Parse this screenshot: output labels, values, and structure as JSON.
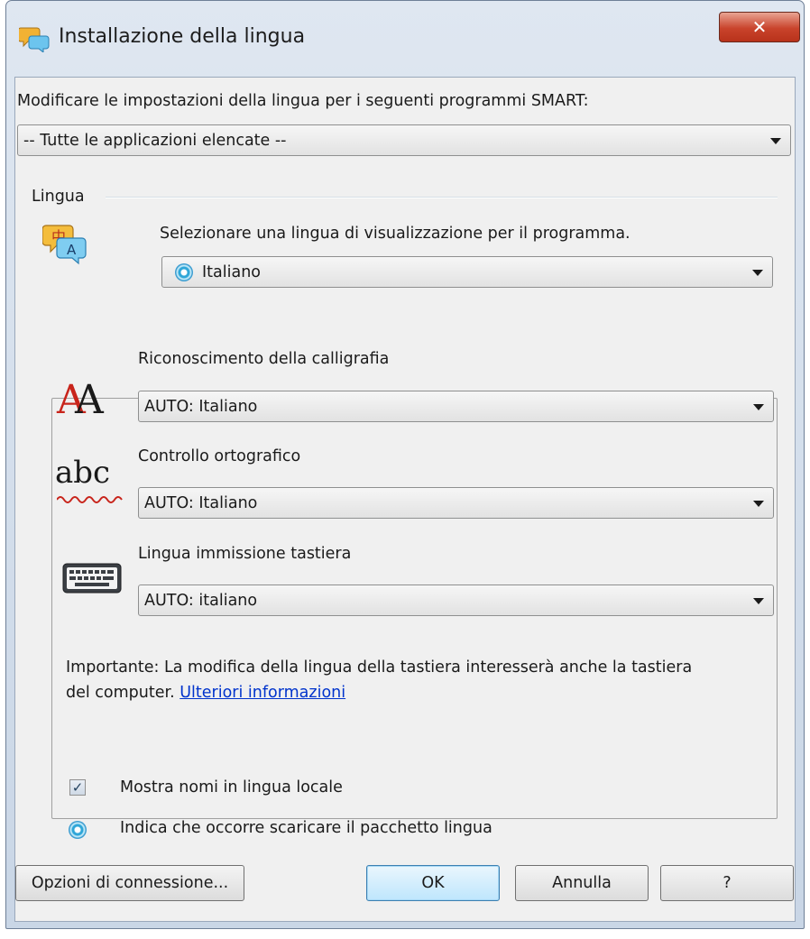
{
  "window": {
    "title": "Installazione della lingua",
    "close_label": "✕"
  },
  "programs": {
    "label": "Modificare le impostazioni della lingua per i seguenti programmi SMART:",
    "selected": "-- Tutte le applicazioni elencate --"
  },
  "language": {
    "group_label": "Lingua",
    "description": "Selezionare una lingua di visualizzazione per il programma.",
    "selected": "Italiano"
  },
  "handwriting": {
    "label": "Riconoscimento della calligrafia",
    "selected": "AUTO: Italiano"
  },
  "spellcheck": {
    "label": "Controllo ortografico",
    "icon_text": "abc",
    "selected": "AUTO: Italiano"
  },
  "keyboard": {
    "label": "Lingua immissione tastiera",
    "selected": "AUTO: italiano"
  },
  "note": {
    "text": "Importante: La modifica della lingua della tastiera interesserà anche la tastiera",
    "text2": "del computer.",
    "link": "Ulteriori informazioni"
  },
  "options": {
    "show_local_names": "Mostra nomi in lingua locale",
    "show_local_names_checked": true,
    "download_indicator": "Indica che occorre scaricare il pacchetto lingua"
  },
  "buttons": {
    "connection": "Opzioni di connessione...",
    "ok": "OK",
    "cancel": "Annulla",
    "help": "?"
  },
  "colors": {
    "close_red": "#c9432b",
    "link_blue": "#0033cc",
    "default_button_border": "#3c7fb1"
  }
}
